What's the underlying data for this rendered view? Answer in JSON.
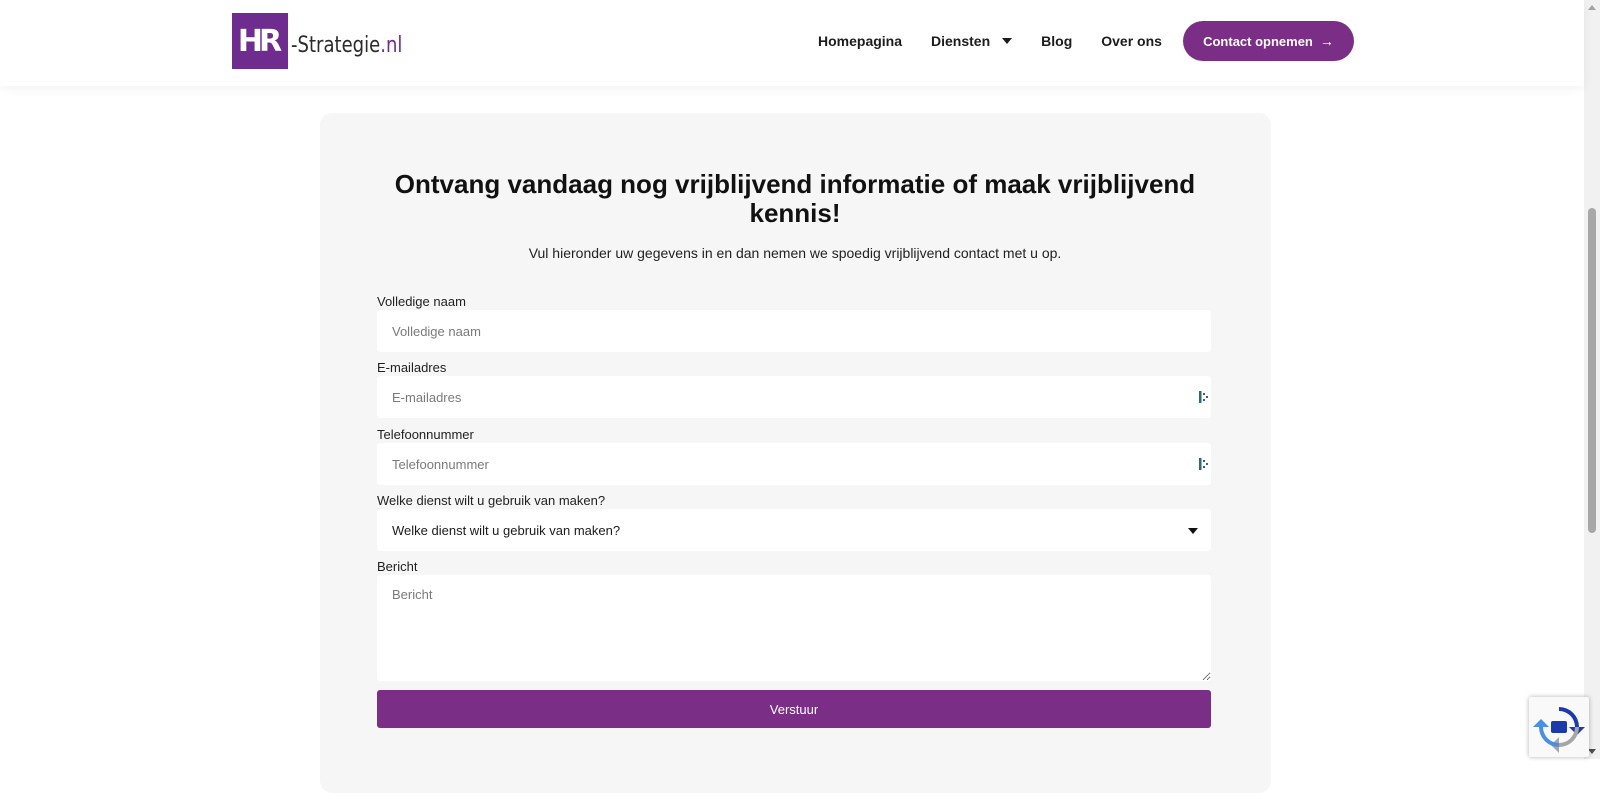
{
  "logo": {
    "mark": "HR",
    "name": "-Strategie",
    "tld": ".nl"
  },
  "nav": {
    "items": [
      {
        "label": "Homepagina"
      },
      {
        "label": "Diensten"
      },
      {
        "label": "Blog"
      },
      {
        "label": "Over ons"
      }
    ],
    "cta_label": "Contact opnemen",
    "cta_arrow": "→"
  },
  "form": {
    "title": "Ontvang vandaag nog vrijblijvend informatie of maak vrijblijvend kennis!",
    "subtitle": "Vul hieronder uw gegevens in en dan nemen we spoedig vrijblijvend contact met u op.",
    "name_label": "Volledige naam",
    "name_placeholder": "Volledige naam",
    "email_label": "E-mailadres",
    "email_placeholder": "E-mailadres",
    "phone_label": "Telefoonnummer",
    "phone_placeholder": "Telefoonnummer",
    "service_label": "Welke dienst wilt u gebruik van maken?",
    "service_selected": "Welke dienst wilt u gebruik van maken?",
    "message_label": "Bericht",
    "message_placeholder": "Bericht",
    "submit_label": "Verstuur"
  },
  "colors": {
    "brand": "#7a2e86",
    "card_bg": "#f6f6f6"
  }
}
